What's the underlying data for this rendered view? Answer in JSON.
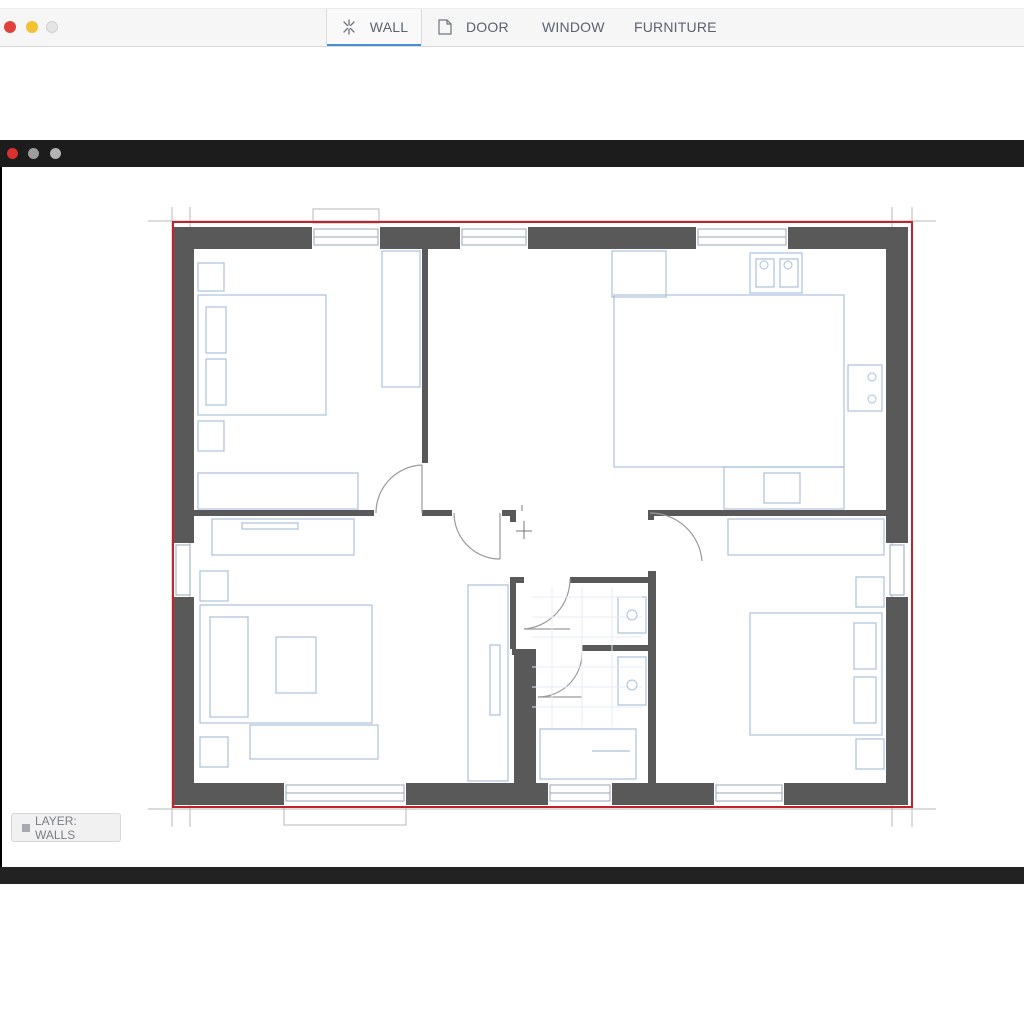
{
  "toolbar": {
    "tabs": [
      {
        "label": "WALL",
        "icon": "wall-tool-icon",
        "active": true
      },
      {
        "label": "DOOR",
        "icon": "door-tool-icon"
      },
      {
        "label": "WINDOW"
      },
      {
        "label": "FURNITURE"
      }
    ],
    "accent_color": "#4a8fd4"
  },
  "status": {
    "layer_label": "LAYER: WALLS"
  },
  "colors": {
    "wall": "#555555",
    "selection": "#c0232a",
    "furniture": "#9db7d6",
    "guide": "#a0a0a0"
  }
}
